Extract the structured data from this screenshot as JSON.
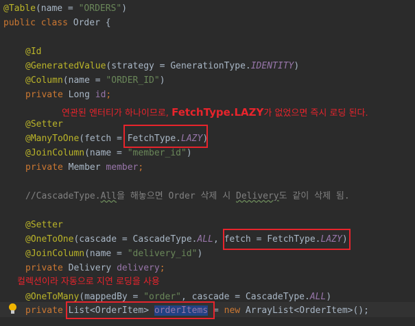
{
  "code": {
    "l1_ann": "@Table",
    "l1_args_open": "(name = ",
    "l1_str": "\"ORDERS\"",
    "l1_close": ")",
    "l2_public": "public",
    "l2_class": "class",
    "l2_name": "Order {",
    "l3_id": "@Id",
    "l4_ann": "@GeneratedValue",
    "l4_args": "(strategy = GenerationType.",
    "l4_const": "IDENTITY",
    "l4_close": ")",
    "l5_ann": "@Column",
    "l5_args": "(name = ",
    "l5_str": "\"ORDER_ID\"",
    "l5_close": ")",
    "l6_private": "private",
    "l6_type": "Long",
    "l6_field": "id",
    "l6_semi": ";",
    "l7_ann": "@Setter",
    "l8_ann": "@ManyToOne",
    "l8_args": "(fetch = ",
    "l8_type": "FetchType.",
    "l8_const": "LAZY",
    "l8_close": ")",
    "l9_ann": "@JoinColumn",
    "l9_args": "(name = ",
    "l9_str": "\"member_id\"",
    "l9_close": ")",
    "l10_private": "private",
    "l10_type": "Member",
    "l10_field": "member",
    "l10_semi": ";",
    "l11_comment_a": "//CascadeType.",
    "l11_comment_all": "All",
    "l11_comment_b": "을 해놓으면 Order 삭제 시 ",
    "l11_comment_delivery": "Delivery",
    "l11_comment_c": "도 같이 삭제 됨.",
    "l12_ann": "@Setter",
    "l13_ann": "@OneToOne",
    "l13_args": "(cascade = CascadeType.",
    "l13_const": "ALL",
    "l13_comma": ", ",
    "l13_fetch": "fetch = FetchType.",
    "l13_lazy": "LAZY",
    "l13_close": ")",
    "l14_ann": "@JoinColumn",
    "l14_args": "(name = ",
    "l14_str": "\"delivery_id\"",
    "l14_close": ")",
    "l15_private": "private",
    "l15_type": "Delivery",
    "l15_field": "delivery",
    "l15_semi": ";",
    "l16_ann": "@OneToMany",
    "l16_args": "(mappedBy = ",
    "l16_str": "\"order\"",
    "l16_args2": ", cascade = CascadeType.",
    "l16_const": "ALL",
    "l16_close": ")",
    "l17_private": "private",
    "l17_list": "List<OrderItem>",
    "l17_field": "orderItems",
    "l17_eq": " = ",
    "l17_new": "new",
    "l17_rest": " ArrayList<OrderItem>();"
  },
  "notes": {
    "note1_a": "연관된 엔터티가 하나이므로, ",
    "note1_b": "FetchType.LAZY",
    "note1_c": "가 없었으면 즉시 로딩 된다.",
    "note2": "컬렉션이라 자동으로 지연 로딩을 사용"
  },
  "colors": {
    "background": "#2b2b2b",
    "annotation": "#bbb529",
    "keyword": "#cc7832",
    "string": "#6a8759",
    "field": "#9876aa",
    "highlight_box": "#e8242c",
    "selection": "#214283"
  },
  "icons": {
    "gutter_bulb": "lightbulb-icon"
  }
}
